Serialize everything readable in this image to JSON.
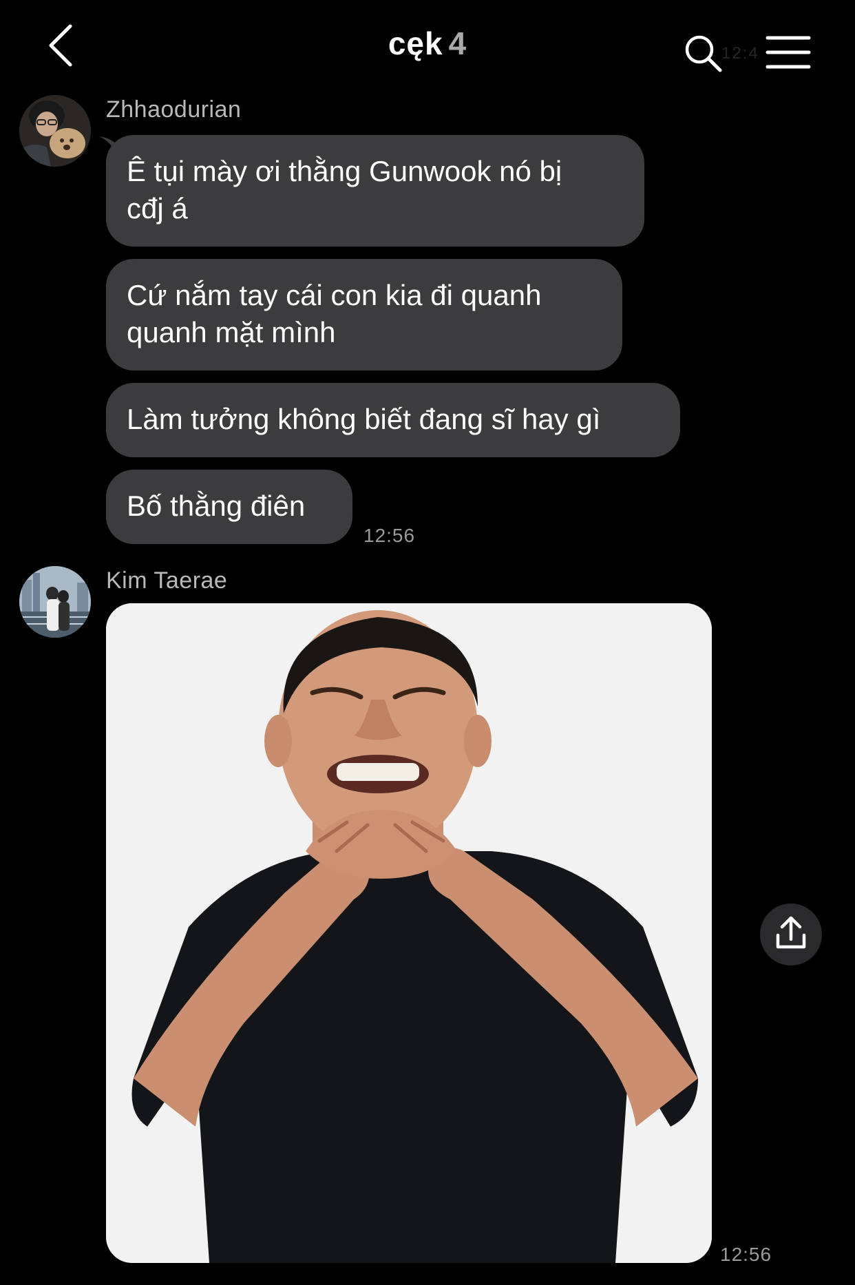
{
  "header": {
    "title": "cęk",
    "member_count": "4",
    "ghost_time": "12:4"
  },
  "messages": [
    {
      "sender": "Zhhaodurian",
      "bubbles": [
        {
          "line1": "Ê tụi mày ơi thằng Gunwook nó bị",
          "line2": "cđj á"
        },
        {
          "line1": "Cứ nắm tay cái con kia đi quanh",
          "line2": "quanh mặt mình"
        },
        {
          "line1": "Làm tưởng không biết đang sĩ hay gì"
        },
        {
          "line1": "Bố thằng điên"
        }
      ],
      "time": "12:56"
    },
    {
      "sender": "Kim Taerae",
      "image": "photo-man-crossed-arms",
      "time": "12:56"
    }
  ],
  "icons": {
    "back": "chevron-left-icon",
    "search": "search-icon",
    "menu": "hamburger-menu-icon",
    "share": "share-upload-icon"
  },
  "colors": {
    "background": "#000000",
    "bubble": "#3c3c3e",
    "sender_text": "#b9b9b9",
    "timestamp": "#9a9a9a"
  }
}
